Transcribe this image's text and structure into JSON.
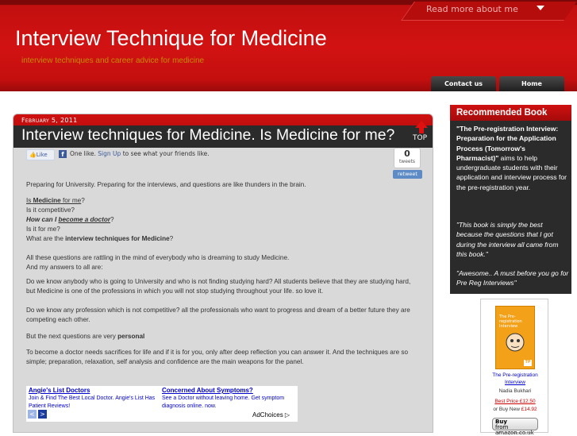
{
  "header": {
    "read_more": "Read more about me",
    "title": "Interview Technique for Medicine",
    "tagline": "interview techniques and career advice for medicine",
    "nav": [
      {
        "label": "Contact us"
      },
      {
        "label": "Home"
      }
    ]
  },
  "post": {
    "date": "February 5, 2011",
    "title": "Interview techniques for Medicine. Is Medicine for me?",
    "top_label": "TOP",
    "social": {
      "like_label": "Like",
      "fb_letter": "f",
      "like_text_pre": "One like.",
      "signup": "Sign Up",
      "like_text_post": "to see what your friends like.",
      "tweet_count": "0",
      "tweet_label": "tweets",
      "retweet_label": "retweet"
    },
    "p1": "Preparing for University. Preparing for the interviews, and questions are like thunders in the brain.",
    "q1_link_a": "Is",
    "q1_link_b": "Medicine",
    "q1_link_c": "for me",
    "q1_end": "?",
    "q2": "Is it competitive?",
    "q3_a": "How can I",
    "q3_b": "become a doctor",
    "q3_c": "?",
    "q4": "Is it for me?",
    "q5_a": "What are the",
    "q5_b": "interview techniques for Medicine",
    "q5_c": "?",
    "p3a": "All these questions are rattling in the mind of everybody who is dreaming to study Medicine.",
    "p3b": "And my answers to all are:",
    "p4": "Do we know anybody who is going to University and who is not finding studying hard? All students believe that they are studying hard, but Medicine is one of the professions in which you will not stop studying throughout your life. so love it.",
    "p5": "Do we know any profession which is not competitive? all the professionals who want to progress and dream of a better future they are competing each other.",
    "p6_a": "But the next questions are very",
    "p6_b": "personal",
    "p7": "To become a doctor needs sacrifices for life and if it is for you, only after deep reflection you can answer it. And the techniques are so simple; preparation, relaxation, self analysis and confidence are the main weapons for the panel."
  },
  "ads": {
    "items": [
      {
        "title": "Angie's List Doctors",
        "desc": "Join & Find The Best Local Doctor. Angie's List Has Patient Reviews!"
      },
      {
        "title": "Concerned About Symptoms?",
        "desc": "See a Doctor without leaving home. Get symptom diagnosis online. now."
      }
    ],
    "prev": "<",
    "next": ">",
    "adchoices": "AdChoices ▷"
  },
  "sidebar": {
    "heading": "Recommended Book",
    "book_bold": "\"The Pre-registration Interview: Preparation for the Application Process (Tomorrow's Pharmacist)\"",
    "book_desc": "aims to help undergraduate students with their application and interview process for the pre-registration year.",
    "quote1": "\"This book is simply the best because the questions that I got during the interview all came from this book.\"",
    "quote2": "\"Awesome.. A must before you go for Pre Reg Interviews\""
  },
  "book_widget": {
    "cover_title": "The Pre-registration Interview",
    "cover_badge": "TP",
    "title_line1": "The Pre-registration",
    "title_line2": "Interview",
    "author": "Nadia Bukhari",
    "best_price": "Best Price £12.50",
    "buy_new_a": "or Buy New",
    "buy_new_b": "£14.92",
    "amazon_label_a": "Buy",
    "amazon_label_b": "from amazon.co.uk",
    "privacy": "Privacy Information"
  },
  "colors": {
    "header_red": "#c20f0f",
    "post_bg": "#d9d9d9",
    "sidebar_bg": "#2b2b2b",
    "link_blue": "#0000cc"
  }
}
